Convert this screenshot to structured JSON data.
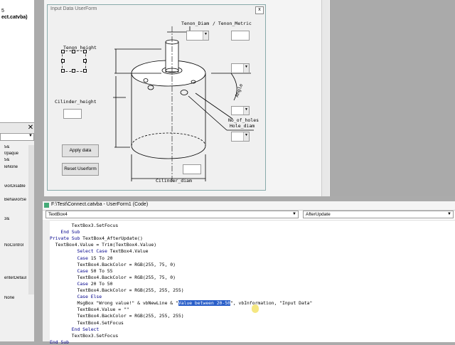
{
  "left_panel": {
    "project_text_1": "5",
    "project_text_2": "ect.catvba)",
    "props_close": "✕",
    "properties": [
      "5&",
      "0paque",
      "5&",
      "leNone",
      "",
      "",
      "viorDisable",
      "",
      "BehaviorSe",
      "",
      "",
      "3&",
      "",
      "",
      "",
      "NoControl",
      "",
      "",
      "",
      "",
      "enterDefaul",
      "",
      "",
      "None"
    ]
  },
  "userform": {
    "title": "Input Data UserForm",
    "close": "x",
    "labels": {
      "tenon_diam": "Tenon_Diam",
      "tenon_metric": "/ Tenon_Metric",
      "tenon_height": "Tenon_height",
      "cylinder_height": "Cilinder_height",
      "angle": "Angle",
      "no_of_holes": "No_of_holes",
      "hole_diam": "Hole_diam",
      "cylinder_diam": "Cilinder_diam"
    },
    "buttons": {
      "apply": "Apply data",
      "reset": "Reset Userform"
    }
  },
  "code_window": {
    "title": "F:\\Test\\Connect.catvba - UserForm1 (Code)",
    "object_combo": "TextBox4",
    "procedure_combo": "AfterUpdate",
    "lines": [
      {
        "indent": "        ",
        "text": "TextBox3.SetFocus"
      },
      {
        "indent": "    ",
        "kw": "End Sub",
        "text": ""
      },
      {
        "indent": "",
        "kw": "Private Sub",
        "text": " TextBox4_AfterUpdate()"
      },
      {
        "indent": "  ",
        "text": "TextBox4.Value = Trim(TextBox4.Value)"
      },
      {
        "indent": "          ",
        "kw": "Select Case",
        "text": " TextBox4.Value"
      },
      {
        "indent": "          ",
        "kw": "Case",
        "text": " 15 To 20"
      },
      {
        "indent": "          ",
        "text": "TextBox4.BackColor = RGB(255, 75, 0)"
      },
      {
        "indent": "          ",
        "kw": "Case",
        "text": " 50 To 55"
      },
      {
        "indent": "          ",
        "text": "TextBox4.BackColor = RGB(255, 75, 0)"
      },
      {
        "indent": "          ",
        "kw": "Case",
        "text": " 20 To 50"
      },
      {
        "indent": "          ",
        "text": "TextBox4.BackColor = RGB(255, 255, 255)"
      },
      {
        "indent": "          ",
        "kw": "Case Else",
        "text": ""
      },
      {
        "indent": "          ",
        "text": "MsgBox \"Wrong value!\" & vbNewLine & \"",
        "sel": "Value between 20-50",
        "after": "\", vbInformation, \"Input Data\""
      },
      {
        "indent": "          ",
        "text": "TextBox4.Value = \"\""
      },
      {
        "indent": "          ",
        "text": "TextBox4.BackColor = RGB(255, 255, 255)"
      },
      {
        "indent": "          ",
        "text": "TextBox4.SetFocus"
      },
      {
        "indent": "        ",
        "kw": "End Select",
        "text": ""
      },
      {
        "indent": "        ",
        "text": "TextBox3.SetFocus"
      },
      {
        "indent": "",
        "kw": "End Sub",
        "text": ""
      }
    ]
  }
}
